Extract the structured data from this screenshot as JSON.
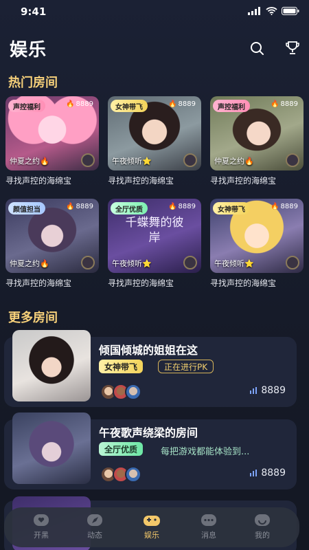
{
  "status": {
    "time": "9:41"
  },
  "header": {
    "title": "娱乐"
  },
  "hot": {
    "section_title": "热门房间",
    "rooms": [
      {
        "badge": "声控福利",
        "heat": "8889",
        "host": "仲夏之约",
        "host_emoji": "🔥",
        "name": "寻找声控的海绵宝"
      },
      {
        "badge": "女神带飞",
        "heat": "8889",
        "host": "午夜倾听",
        "host_emoji": "⭐",
        "name": "寻找声控的海绵宝"
      },
      {
        "badge": "声控福利",
        "heat": "8889",
        "host": "仲夏之约",
        "host_emoji": "🔥",
        "name": "寻找声控的海绵宝"
      },
      {
        "badge": "颜值担当",
        "heat": "8889",
        "host": "仲夏之约",
        "host_emoji": "🔥",
        "name": "寻找声控的海绵宝"
      },
      {
        "badge": "全厅优质",
        "heat": "8889",
        "host": "午夜倾听",
        "host_emoji": "⭐",
        "name": "寻找声控的海绵宝"
      },
      {
        "badge": "女神带飞",
        "heat": "8889",
        "host": "午夜倾听",
        "host_emoji": "⭐",
        "name": "寻找声控的海绵宝"
      }
    ],
    "poster_text": "千蝶舞的彼岸"
  },
  "more": {
    "section_title": "更多房间",
    "rooms": [
      {
        "title": "倾国倾城的姐姐在这",
        "tag": "女神带飞",
        "extra": "正在进行PK",
        "count": "8889"
      },
      {
        "title": "午夜歌声绕梁的房间",
        "tag": "全厅优质",
        "extra": "每把游戏都能体验到...",
        "count": "8889"
      }
    ]
  },
  "tabs": [
    {
      "label": "开黑"
    },
    {
      "label": "动态"
    },
    {
      "label": "娱乐"
    },
    {
      "label": "消息"
    },
    {
      "label": "我的"
    }
  ],
  "colors": {
    "accent": "#f3c86a",
    "section": "#f6d07a",
    "card": "#20263a"
  }
}
